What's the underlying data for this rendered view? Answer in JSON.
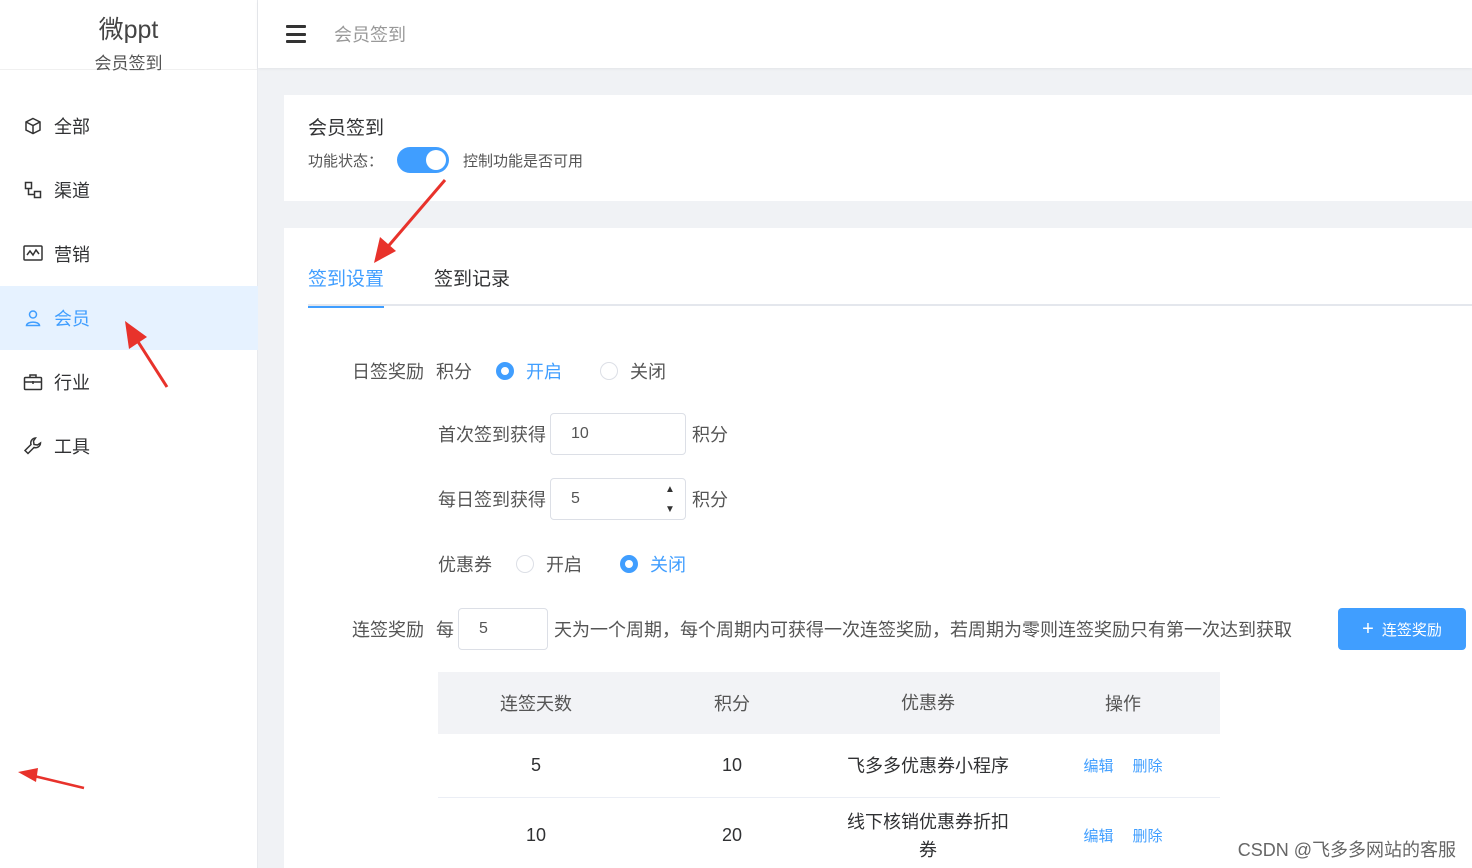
{
  "brand": {
    "title": "微ppt",
    "subtitle": "会员签到"
  },
  "sidebar": {
    "items": [
      {
        "label": "全部",
        "icon": "cube-icon"
      },
      {
        "label": "渠道",
        "icon": "channel-icon"
      },
      {
        "label": "营销",
        "icon": "chart-icon"
      },
      {
        "label": "会员",
        "icon": "user-icon",
        "active": true
      },
      {
        "label": "行业",
        "icon": "briefcase-icon"
      },
      {
        "label": "工具",
        "icon": "wrench-icon"
      }
    ]
  },
  "header": {
    "breadcrumb": "会员签到"
  },
  "feature": {
    "title": "会员签到",
    "status_label": "功能状态：",
    "status_hint": "控制功能是否可用",
    "enabled": true
  },
  "tabs": [
    {
      "label": "签到设置",
      "active": true
    },
    {
      "label": "签到记录"
    }
  ],
  "daily": {
    "label": "日签奖励",
    "points_label": "积分",
    "on": "开启",
    "off": "关闭",
    "first_label": "首次签到获得",
    "first_value": "10",
    "unit": "积分",
    "each_label": "每日签到获得",
    "each_value": "5",
    "coupon_label": "优惠券",
    "coupon_on": "开启",
    "coupon_off": "关闭"
  },
  "consecutive": {
    "label": "连签奖励",
    "every": "每",
    "cycle_value": "5",
    "description": "天为一个周期，每个周期内可获得一次连签奖励，若周期为零则连签奖励只有第一次达到获取",
    "add_button": "连签奖励"
  },
  "table": {
    "headers": [
      "连签天数",
      "积分",
      "优惠券",
      "操作"
    ],
    "rows": [
      {
        "days": "5",
        "points": "10",
        "coupon": "飞多多优惠券小程序"
      },
      {
        "days": "10",
        "points": "20",
        "coupon_line1": "线下核销优惠券折扣",
        "coupon_line2": "券"
      }
    ],
    "edit": "编辑",
    "delete": "删除"
  },
  "watermark": "CSDN @飞多多网站的客服",
  "colors": {
    "primary": "#409eff",
    "annotation": "#e8322b"
  }
}
